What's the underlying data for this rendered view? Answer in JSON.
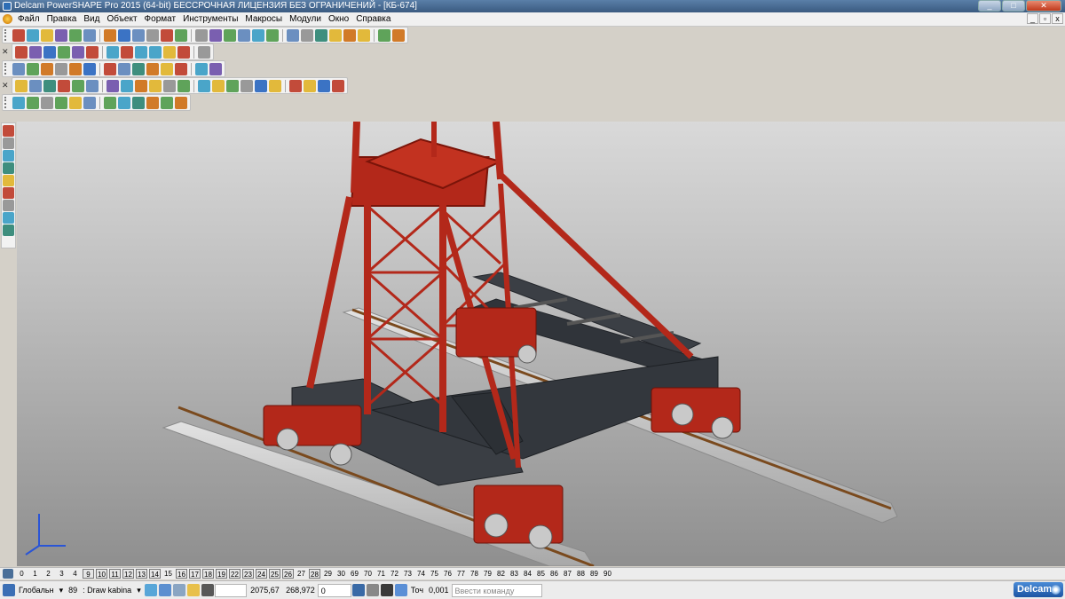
{
  "window": {
    "title": "Delcam PowerSHAPE Pro 2015 (64-bit) БЕССРОЧНАЯ ЛИЦЕНЗИЯ БЕЗ ОГРАНИЧЕНИЙ - [КБ-674]"
  },
  "menu": {
    "items": [
      "Файл",
      "Правка",
      "Вид",
      "Объект",
      "Формат",
      "Инструменты",
      "Макросы",
      "Модули",
      "Окно",
      "Справка"
    ]
  },
  "toolbars": {
    "row1_icons": [
      "new-file-icon",
      "open-file-icon",
      "open-model-icon",
      "save-icon",
      "print-icon",
      "mail-icon",
      "cut-icon",
      "copy-icon",
      "paste-icon",
      "pen-icon",
      "scissors-icon",
      "undo-icon",
      "redo-icon",
      "help-icon",
      "model-icon",
      "axis-icon",
      "line-icon",
      "circle-icon",
      "curve-icon",
      "arc-icon",
      "text-icon",
      "pin-icon",
      "solid-icon",
      "surface-icon",
      "drive-icon",
      "wizard-icon"
    ],
    "row2_icons": [
      "view-box-icon",
      "view-frame-icon",
      "view-copy-icon",
      "view-iso-icon",
      "view-rotate-icon",
      "pan-icon",
      "zoom-icon",
      "zoom-in-icon",
      "zoom-out-icon",
      "globe-icon",
      "shaded-icon",
      "light-icon",
      "hand-icon"
    ],
    "row3_icons": [
      "wireframe-icon",
      "list-icon",
      "sheet-icon",
      "shade-green-icon",
      "cube-blue-icon",
      "sphere-red-icon",
      "cone-green-icon",
      "triangle-icon",
      "box-orange-icon",
      "grid-icon",
      "layers-icon",
      "group-icon",
      "camera-icon",
      "mesh-icon"
    ],
    "row4_icons": [
      "select-icon",
      "sketch-icon",
      "arc-tool-icon",
      "copy-tool-icon",
      "frame-icon",
      "rect-icon",
      "blend-icon",
      "rotate-tool-icon",
      "measure-icon",
      "dimension-icon",
      "solid-gray-icon",
      "hole-icon",
      "fillet-icon",
      "chamfer-icon",
      "shell-icon",
      "draft-icon",
      "boolean-icon",
      "split-icon",
      "pipe-icon",
      "grid-tool-icon",
      "tools-icon",
      "ruler-icon"
    ],
    "row5_icons": [
      "surface-gray-icon",
      "axes-icon",
      "move-icon",
      "assembly-icon",
      "gear-icon",
      "part-icon",
      "component-icon",
      "cube-yellow-icon",
      "constraint-icon",
      "mate-icon",
      "explode-icon",
      "view-fit-icon"
    ],
    "left_icons": [
      "pointer-icon",
      "snap-icon",
      "lathe-icon",
      "extrude-icon",
      "loft-icon",
      "sweep-icon",
      "cylinder-icon",
      "revolve-icon",
      "cube-green-icon"
    ]
  },
  "layers": {
    "items": [
      "0",
      "1",
      "2",
      "3",
      "4",
      "9",
      "10",
      "11",
      "12",
      "13",
      "14",
      "15",
      "16",
      "17",
      "18",
      "19",
      "22",
      "23",
      "24",
      "25",
      "26",
      "27",
      "28",
      "29",
      "30",
      "69",
      "70",
      "71",
      "72",
      "73",
      "74",
      "75",
      "76",
      "77",
      "78",
      "79",
      "82",
      "83",
      "84",
      "85",
      "86",
      "87",
      "88",
      "89",
      "90"
    ],
    "boxed": [
      "9",
      "10",
      "11",
      "12",
      "13",
      "14",
      "16",
      "17",
      "18",
      "19",
      "22",
      "23",
      "24",
      "25",
      "26",
      "28"
    ]
  },
  "status": {
    "workplane": "Глобальн",
    "level": "89",
    "level_name": "Draw kabina",
    "x": "2075,67",
    "y": "268,972",
    "z": "0",
    "tolerance_label": "Точ",
    "tolerance": "0,001",
    "command_placeholder": "Ввести команду"
  },
  "brand": {
    "name": "Delcam"
  },
  "colors": {
    "tower_red": "#b3281a",
    "frame_dark": "#33363b",
    "rail_gray": "#a9a9a9",
    "viewport_top": "#d9d9d9",
    "viewport_bottom": "#8f8f8f"
  }
}
